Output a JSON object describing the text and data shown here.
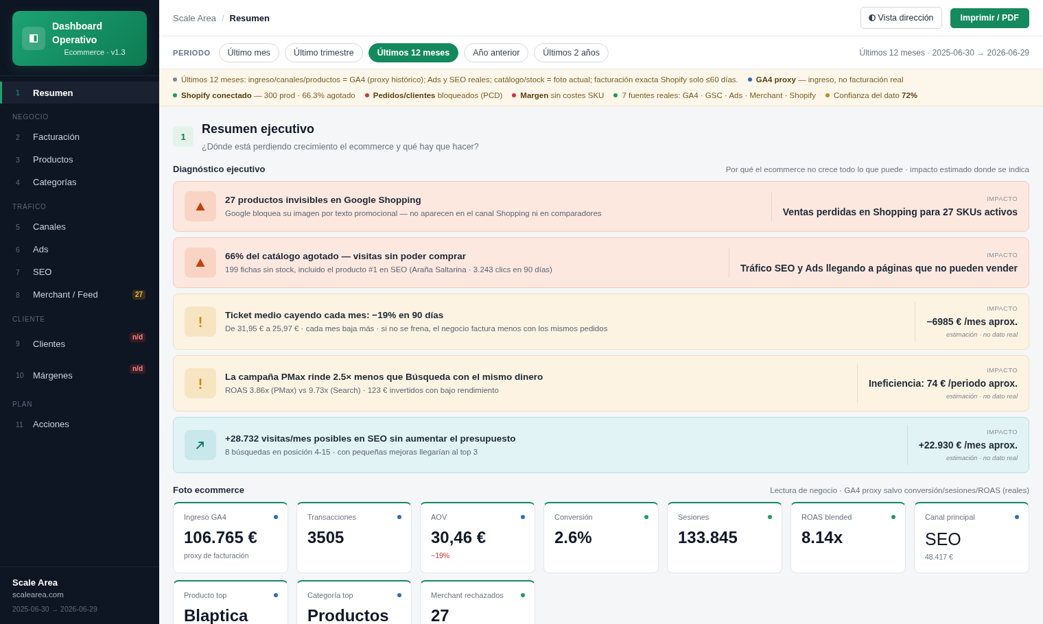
{
  "sidebar": {
    "brand": {
      "title": "Dashboard Operativo",
      "subtitle": "Ecommerce · v1.3"
    },
    "sections": [
      {
        "items": [
          {
            "number": "1",
            "label": "Resumen",
            "selected": true
          }
        ]
      },
      {
        "title": "NEGOCIO",
        "items": [
          {
            "number": "2",
            "label": "Facturación",
            "selected": false
          },
          {
            "number": "3",
            "label": "Productos",
            "selected": false
          },
          {
            "number": "4",
            "label": "Categorías",
            "selected": false
          }
        ]
      },
      {
        "title": "TRÁFICO",
        "items": [
          {
            "number": "5",
            "label": "Canales",
            "selected": false
          },
          {
            "number": "6",
            "label": "Ads",
            "selected": false
          },
          {
            "number": "7",
            "label": "SEO",
            "selected": false
          },
          {
            "number": "8",
            "label": "Merchant / Feed",
            "selected": false,
            "badge": {
              "text": "27",
              "kind": "count"
            }
          }
        ]
      },
      {
        "title": "CLIENTE",
        "items": [
          {
            "number": "9",
            "label": "Clientes",
            "selected": false,
            "badge": {
              "text": "n/d",
              "kind": "unavailable"
            }
          },
          {
            "number": "10",
            "label": "Márgenes",
            "selected": false,
            "badge": {
              "text": "n/d",
              "kind": "unavailable"
            }
          }
        ]
      },
      {
        "title": "PLAN",
        "items": [
          {
            "number": "11",
            "label": "Acciones",
            "selected": false
          }
        ]
      }
    ],
    "footer": {
      "name": "Scale Area",
      "domain": "scalearea.com",
      "range": "2025-06-30 → 2026-06-29"
    }
  },
  "topbar": {
    "breadcrumb": [
      "Scale Area",
      "Resumen"
    ],
    "separator": "/",
    "actions": [
      {
        "label": "Vista dirección",
        "kind": "secondary"
      },
      {
        "label": "Imprimir / PDF",
        "kind": "primary"
      }
    ]
  },
  "period": {
    "label": "PERIODO",
    "options": [
      {
        "label": "Último mes",
        "selected": false
      },
      {
        "label": "Último trimestre",
        "selected": false
      },
      {
        "label": "Últimos 12 meses",
        "selected": true
      },
      {
        "label": "Año anterior",
        "selected": false
      },
      {
        "label": "Últimos 2 años",
        "selected": false
      }
    ],
    "range": "Últimos 12 meses · 2025-06-30 → 2026-06-29"
  },
  "notices": {
    "lines": [
      {
        "items": [
          {
            "color": "#7d8596",
            "text": "Últimos 12 meses: ingreso/canales/productos = GA4 (proxy histórico); Ads y SEO reales; catálogo/stock = foto actual; facturación exacta Shopify solo ≤60 días."
          },
          {
            "color": "#2f6db5",
            "text": "**GA4 proxy** — ingreso, no facturación real"
          }
        ]
      },
      {
        "items": [
          {
            "color": "#1f9d5b",
            "text": "**Shopify conectado** — 300 prod · 66.3% agotado"
          },
          {
            "color": "#cf3a3a",
            "text": "**Pedidos/clientes** bloqueados (PCD)"
          },
          {
            "color": "#cf3a3a",
            "text": "**Margen** sin costes SKU"
          },
          {
            "color": "#1f9d5b",
            "text": "7 fuentes reales: GA4 · GSC · Ads · Merchant · Shopify"
          },
          {
            "color": "#c98a1a",
            "text": "Confianza del dato **72%**"
          }
        ]
      }
    ]
  },
  "summary": {
    "number": "1",
    "title": "Resumen ejecutivo",
    "subtitle": "¿Dónde está perdiendo crecimiento el ecommerce y qué hay que hacer?"
  },
  "diagnosis": {
    "title": "Diagnóstico ejecutivo",
    "note": "Por qué el ecommerce no crece todo lo que puede · impacto estimado donde se indica",
    "cards": [
      {
        "kind": "critical",
        "title": "27 productos invisibles en Google Shopping",
        "description": "Google bloquea su imagen por texto promocional — no aparecen en el canal Shopping ni en comparadores",
        "impact_label": "IMPACTO",
        "impact": "Ventas perdidas en Shopping para 27 SKUs activos"
      },
      {
        "kind": "critical",
        "title": "66% del catálogo agotado — visitas sin poder comprar",
        "description": "199 fichas sin stock, incluido el producto #1 en SEO (Araña Saltarina · 3.243 clics en 90 días)",
        "impact_label": "IMPACTO",
        "impact": "Tráfico SEO y Ads llegando a páginas que no pueden vender"
      },
      {
        "kind": "warning",
        "title": "Ticket medio cayendo cada mes: −19% en 90 días",
        "description": "De 31,95 € a 25,97 € · cada mes baja más · si no se frena, el negocio factura menos con los mismos pedidos",
        "impact_label": "IMPACTO",
        "impact": "−6985 € /mes aprox.",
        "impact_note": "estimación · no dato real"
      },
      {
        "kind": "warning",
        "title": "La campaña PMax rinde 2.5× menos que Búsqueda con el mismo dinero",
        "description": "ROAS 3.86x (PMax) vs 9.73x (Search) · 123 € invertidos con bajo rendimiento",
        "impact_label": "IMPACTO",
        "impact": "Ineficiencia: 74 € /periodo aprox.",
        "impact_note": "estimación · no dato real"
      },
      {
        "kind": "opportunity",
        "title": "+28.732 visitas/mes posibles en SEO sin aumentar el presupuesto",
        "description": "8 búsquedas en posición 4-15 · con pequeñas mejoras llegarían al top 3",
        "impact_label": "IMPACTO",
        "impact": "+22.930 € /mes aprox.",
        "impact_note": "estimación · no dato real"
      }
    ]
  },
  "kpis": {
    "title": "Foto ecommerce",
    "note": "Lectura de negocio · GA4 proxy salvo conversión/sesiones/ROAS (reales)",
    "cards": [
      {
        "label": "Ingreso GA4",
        "color": "#2f6db5",
        "kind": "metric",
        "value": "106.765 €",
        "sub": {
          "text": "proxy de facturación",
          "negative": false
        }
      },
      {
        "label": "Transacciones",
        "color": "#2f6db5",
        "kind": "metric",
        "value": "3505"
      },
      {
        "label": "AOV",
        "color": "#2f6db5",
        "kind": "metric",
        "value": "30,46 €",
        "sub": {
          "text": "−19%",
          "negative": true
        }
      },
      {
        "label": "Conversión",
        "color": "#1f9d5b",
        "kind": "metric",
        "value": "2.6%"
      },
      {
        "label": "Sesiones",
        "color": "#1f9d5b",
        "kind": "metric",
        "value": "133.845"
      },
      {
        "label": "ROAS blended",
        "color": "#1f9d5b",
        "kind": "metric",
        "value": "8.14x"
      },
      {
        "label": "Canal principal",
        "color": "#2f6db5",
        "kind": "text",
        "value": "SEO",
        "sub": {
          "text": "48.417 €",
          "negative": false
        }
      },
      {
        "label": "Producto top",
        "color": "#2f6db5",
        "kind": "metric",
        "value": "Blaptica"
      },
      {
        "label": "Categoría top",
        "color": "#2f6db5",
        "kind": "metric",
        "value": "Productos"
      },
      {
        "label": "Merchant rechazados",
        "color": "#1f9d5b",
        "kind": "metric",
        "value": "27"
      }
    ]
  }
}
